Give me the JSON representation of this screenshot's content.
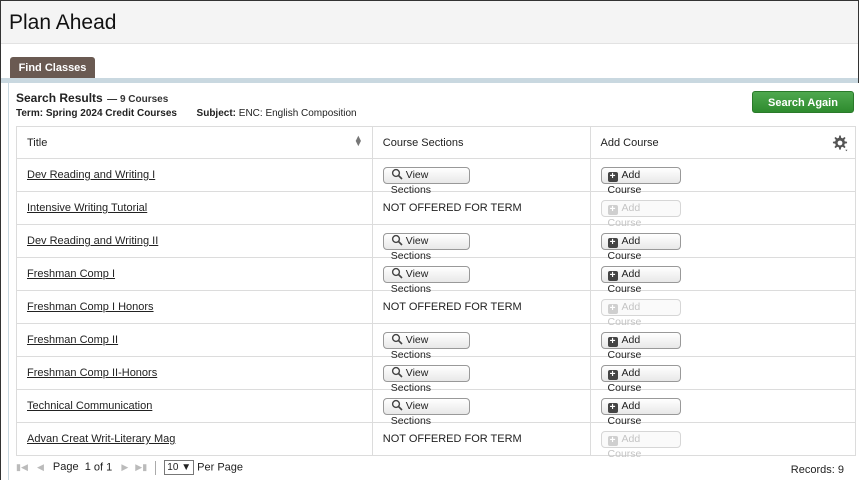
{
  "page": {
    "title": "Plan Ahead"
  },
  "tabs": [
    {
      "label": "Find Classes"
    }
  ],
  "results": {
    "title": "Search Results",
    "count": "— 9 Courses",
    "term_label": "Term:",
    "term_value": "Spring 2024 Credit Courses",
    "subject_label": "Subject:",
    "subject_value": "ENC: English Composition",
    "search_again_label": "Search Again"
  },
  "table": {
    "headers": {
      "title": "Title",
      "sections": "Course Sections",
      "add": "Add Course"
    },
    "view_sections_label": "View Sections",
    "add_course_label": "Add Course",
    "not_offered_label": "NOT OFFERED FOR TERM",
    "rows": [
      {
        "title": "Dev Reading and Writing I",
        "offered": true
      },
      {
        "title": "Intensive Writing Tutorial",
        "offered": false
      },
      {
        "title": "Dev Reading and Writing II",
        "offered": true
      },
      {
        "title": "Freshman Comp I",
        "offered": true
      },
      {
        "title": "Freshman Comp I Honors",
        "offered": false
      },
      {
        "title": "Freshman Comp II",
        "offered": true
      },
      {
        "title": "Freshman Comp II-Honors",
        "offered": true
      },
      {
        "title": "Technical Communication",
        "offered": true
      },
      {
        "title": "Advan Creat Writ-Literary Mag",
        "offered": false
      }
    ]
  },
  "pager": {
    "page_label": "Page",
    "current_page": "1",
    "of_label": "of",
    "total_pages": "1",
    "per_page_value": "10",
    "per_page_label": "Per Page",
    "records": "Records: 9"
  },
  "colors": {
    "tab_bg": "#6a5a52",
    "search_again_bg": "#3a993a",
    "tab_rule": "#c9d8e0"
  }
}
